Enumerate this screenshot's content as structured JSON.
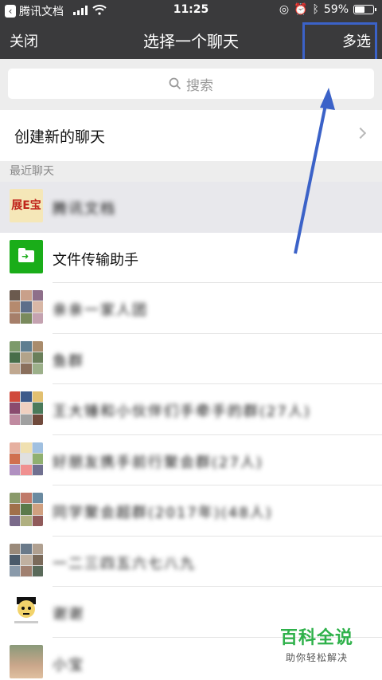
{
  "status_bar": {
    "back_app": "腾讯文档",
    "time": "11:25",
    "battery": "59%",
    "battery_level": 0.59
  },
  "nav": {
    "close": "关闭",
    "title": "选择一个聊天",
    "multi_select": "多选"
  },
  "search": {
    "placeholder": "搜索"
  },
  "new_chat": {
    "label": "创建新的聊天"
  },
  "recent": {
    "section_label": "最近聊天",
    "items": [
      {
        "name": "腾讯文档",
        "avatar_text": "展E宝",
        "blurred": true
      },
      {
        "name": "文件传输助手",
        "blurred": false
      },
      {
        "name": "亲亲一家人团",
        "blurred": true
      },
      {
        "name": "鱼群",
        "blurred": true
      },
      {
        "name": "王大锤和小伙伴们手牵手的群(27人)",
        "blurred": true
      },
      {
        "name": "好朋友携手前行聚会群(27人)",
        "blurred": true
      },
      {
        "name": "同学聚会超群(2017年)(48人)",
        "blurred": true
      },
      {
        "name": "一二三四五六七八九",
        "blurred": true
      },
      {
        "name": "谢谢",
        "blurred": true
      },
      {
        "name": "小宝",
        "blurred": true
      }
    ]
  },
  "watermark": {
    "title": "百科全说",
    "subtitle": "助你轻松解决"
  }
}
